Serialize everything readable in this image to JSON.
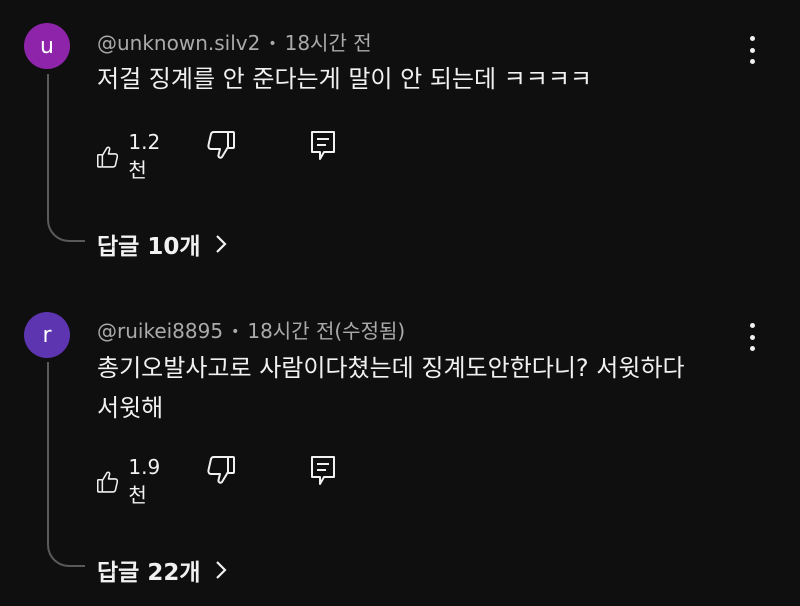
{
  "comments": [
    {
      "avatar_letter": "u",
      "avatar_color": "#8e24aa",
      "author": "@unknown.silv2",
      "time": "18시간 전",
      "text_lines": [
        "저걸 징계를 안 준다는게 말이 안 되는데 ㅋㅋㅋㅋ"
      ],
      "likes": "1.2천",
      "replies_label": "답글 10개"
    },
    {
      "avatar_letter": "r",
      "avatar_color": "#5e35b1",
      "author": "@ruikei8895",
      "time": "18시간 전(수정됨)",
      "text_lines": [
        "총기오발사고로 사람이다쳤는데 징계도안한다니? 서윗하다",
        "서윗해"
      ],
      "likes": "1.9천",
      "replies_label": "답글 22개"
    }
  ],
  "icons": {
    "like": "thumbs-up-icon",
    "dislike": "thumbs-down-icon",
    "reply": "reply-comment-icon",
    "more": "more-vertical-icon",
    "expand": "chevron-right-icon"
  },
  "meta_separator": "•"
}
